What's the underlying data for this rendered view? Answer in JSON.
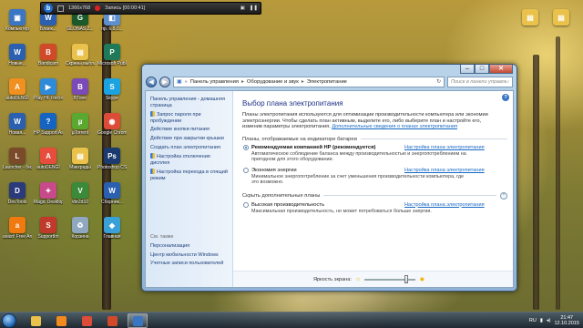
{
  "recorder": {
    "resolution": "1366x768",
    "recording_status": "Запись [00:00:41]"
  },
  "desktop_icons": [
    {
      "label": "Компьютер",
      "color": "#3b76c4",
      "glyph": "▣"
    },
    {
      "label": "Бланк...",
      "color": "#2b5fb0",
      "glyph": "W"
    },
    {
      "label": "GLONAS 2...",
      "color": "#1a5a2a",
      "glyph": "G"
    },
    {
      "label": "пр. 6.8.0...",
      "color": "#5d8fd1",
      "glyph": "◧"
    },
    {
      "label": "Новые...",
      "color": "#2b5fb0",
      "glyph": "W"
    },
    {
      "label": "Bandicam",
      "color": "#d04a2a",
      "glyph": "B"
    },
    {
      "label": "Скрины выплат",
      "color": "#e9c14b",
      "glyph": "▤"
    },
    {
      "label": "Microsoft Publisher",
      "color": "#1f7a5a",
      "glyph": "P"
    },
    {
      "label": "autoDENGI",
      "color": "#f09020",
      "glyph": "A"
    },
    {
      "label": "Play HF Recovery",
      "color": "#2f8ad8",
      "glyph": "▶"
    },
    {
      "label": "BTone",
      "color": "#7a4ab8",
      "glyph": "B"
    },
    {
      "label": "Skype",
      "color": "#1aa3e0",
      "glyph": "S"
    },
    {
      "label": "Новая...",
      "color": "#2b5fb0",
      "glyph": "W"
    },
    {
      "label": "HP Support Assistant",
      "color": "#1565c0",
      "glyph": "?"
    },
    {
      "label": "µTorrent",
      "color": "#5aa830",
      "glyph": "µ"
    },
    {
      "label": "Google Chrome",
      "color": "#dd4b39",
      "glyph": "◉"
    },
    {
      "label": "Launcher - бизнесы",
      "color": "#7b4a2a",
      "glyph": "L"
    },
    {
      "label": "autoDENGI",
      "color": "#e74c3c",
      "glyph": "A"
    },
    {
      "label": "Макхрады",
      "color": "#e9c14b",
      "glyph": "▤"
    },
    {
      "label": "Photoshop CS 6 Ru",
      "color": "#1b3a6f",
      "glyph": "Ps"
    },
    {
      "label": "DevTools",
      "color": "#2a3a7a",
      "glyph": "D"
    },
    {
      "label": "Magic Desktop",
      "color": "#c94a8a",
      "glyph": "✦"
    },
    {
      "label": "vbr2d10",
      "color": "#3a8a3a",
      "glyph": "V"
    },
    {
      "label": "Сборник...",
      "color": "#2b5fb0",
      "glyph": "W"
    },
    {
      "label": "avast! Free Antivirus",
      "color": "#f07a10",
      "glyph": "a"
    },
    {
      "label": "SupportIm",
      "color": "#c0392b",
      "glyph": "S"
    },
    {
      "label": "Корзина",
      "color": "#8fa7bf",
      "glyph": "♻"
    },
    {
      "label": "Главная",
      "color": "#3aa0d8",
      "glyph": "◆"
    }
  ],
  "window": {
    "address": {
      "segments": [
        "Панель управления",
        "Оборудование и звук",
        "Электропитание"
      ]
    },
    "search_placeholder": "Поиск в панели управления",
    "caption_buttons": {
      "minimize": "–",
      "maximize": "□",
      "close": "✕"
    },
    "sidebar": {
      "links": [
        "Панель управления - домашняя страница",
        "Запрос пароля при пробуждении",
        "Действие кнопки питания",
        "Действие при закрытии крышки",
        "Создать план электропитания",
        "Настройка отключения дисплея",
        "Настройка перехода в спящий режим"
      ],
      "see_also_header": "См. также",
      "see_also": [
        "Персонализация",
        "Центр мобильности Windows",
        "Учетные записи пользователей"
      ]
    },
    "main": {
      "title": "Выбор плана электропитания",
      "description": "Планы электропитания используются для оптимизации производительности компьютера или экономии электроэнергии. Чтобы сделать план активным, выделите его, либо выберите план и настройте его, изменив параметры электропитания.",
      "description_link": "Дополнительные сведения о планах электропитания",
      "group_battery": "Планы, отображаемые на индикаторе батареи",
      "plans": [
        {
          "name": "Рекомендуемая компанией HP (рекомендуется)",
          "selected": true,
          "settings_link": "Настройка плана электропитания",
          "description": "Автоматическое соблюдение баланса между производительностью и энергопотреблением на пригодном для этого оборудовании."
        },
        {
          "name": "Экономия энергии",
          "selected": false,
          "settings_link": "Настройка плана электропитания",
          "description": "Минимальное энергопотребление за счет уменьшения производительности компьютера, где это возможно."
        }
      ],
      "group_hidden": "Скрыть дополнительные планы",
      "extra_plans": [
        {
          "name": "Высокая производительность",
          "selected": false,
          "settings_link": "Настройка плана электропитания",
          "description": "Максимальная производительность, но может потребоваться больше энергии."
        }
      ]
    },
    "footer": {
      "brightness_label": "Яркость экрана:",
      "brightness_level": 0.85
    }
  },
  "taskbar": {
    "apps": [
      {
        "name": "explorer",
        "color": "#e9c14b"
      },
      {
        "name": "media-player",
        "color": "#f28a1e"
      },
      {
        "name": "chrome",
        "color": "#dd4b39"
      },
      {
        "name": "bandicam",
        "color": "#d04a2a"
      },
      {
        "name": "control-panel",
        "color": "#3b76c4"
      }
    ],
    "language": "RU",
    "time": "21:47",
    "date": "12.10.2015"
  }
}
